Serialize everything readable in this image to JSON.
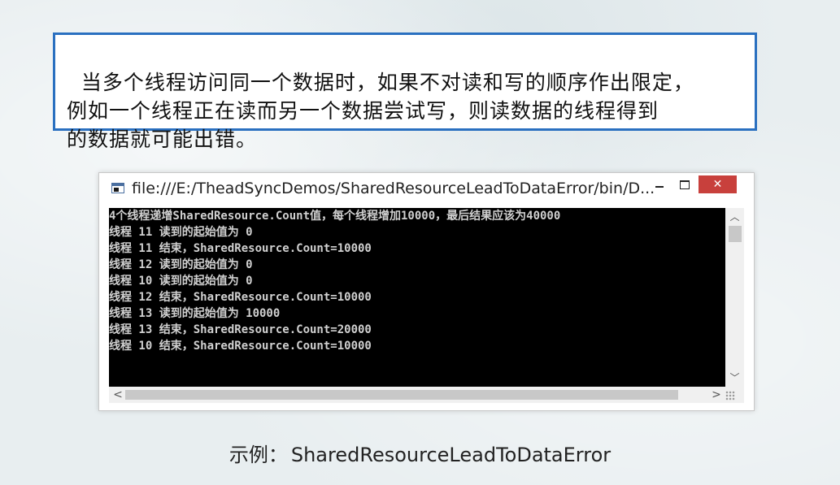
{
  "note": {
    "text": "当多个线程访问同一个数据时，如果不对读和写的顺序作出限定，\n例如一个线程正在读而另一个数据尝试写，则读数据的线程得到\n的数据就可能出错。"
  },
  "window": {
    "title": "file:///E:/TheadSyncDemos/SharedResourceLeadToDataError/bin/D...",
    "minimize_icon": "minimize-icon",
    "maximize_icon": "maximize-icon",
    "close_icon": "close-icon",
    "close_glyph": "✕"
  },
  "console": {
    "lines": [
      "4个线程递增SharedResource.Count值，每个线程增加10000，最后结果应该为40000",
      "线程 11 读到的起始值为 0",
      "线程 11 结束，SharedResource.Count=10000",
      "线程 12 读到的起始值为 0",
      "线程 10 读到的起始值为 0",
      "线程 12 结束，SharedResource.Count=10000",
      "线程 13 读到的起始值为 10000",
      "线程 13 结束，SharedResource.Count=20000",
      "线程 10 结束，SharedResource.Count=10000"
    ]
  },
  "scrollbars": {
    "up_glyph": "︿",
    "down_glyph": "﹀",
    "left_glyph": "<",
    "right_glyph": ">"
  },
  "caption": {
    "label": "示例：",
    "name": "SharedResourceLeadToDataError"
  }
}
